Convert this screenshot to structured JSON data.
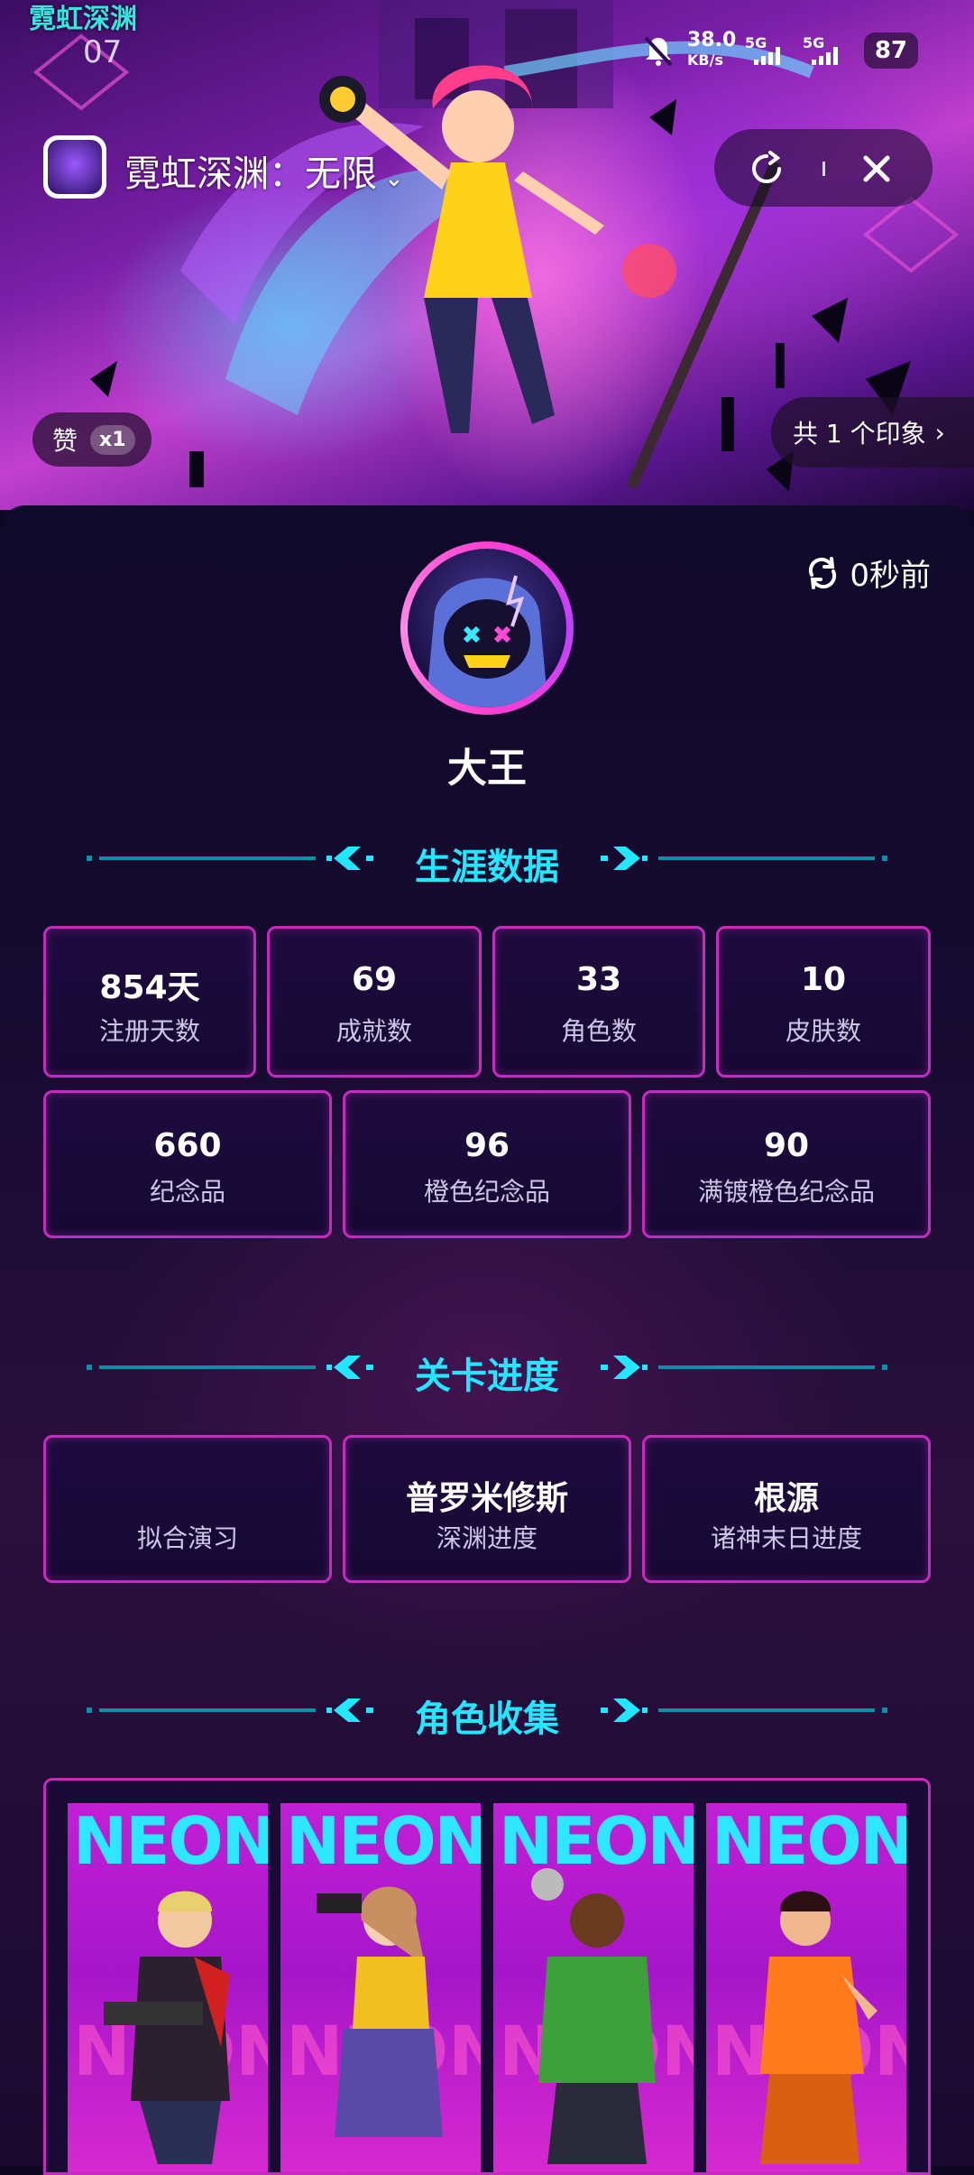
{
  "status_bar": {
    "logo": "霓虹深渊",
    "time": "07",
    "net_speed": "38.0",
    "net_unit": "KB/s",
    "sim1": "5G",
    "sim2": "5G",
    "battery": "87"
  },
  "header": {
    "app_name": "霓虹深渊：无限",
    "caret": "⌄",
    "refresh_icon": "refresh-circle-icon",
    "close_icon": "close-icon"
  },
  "banner": {
    "like_label": "赞",
    "like_count": "x1",
    "impressions": "共 1 个印象",
    "impressions_chevron": "›"
  },
  "profile": {
    "refresh_time": "0秒前",
    "player_name": "大王"
  },
  "career": {
    "title": "生涯数据",
    "row1": [
      {
        "value": "854天",
        "label": "注册天数"
      },
      {
        "value": "69",
        "label": "成就数"
      },
      {
        "value": "33",
        "label": "角色数"
      },
      {
        "value": "10",
        "label": "皮肤数"
      }
    ],
    "row2": [
      {
        "value": "660",
        "label": "纪念品"
      },
      {
        "value": "96",
        "label": "橙色纪念品"
      },
      {
        "value": "90",
        "label": "满镀橙色纪念品"
      }
    ]
  },
  "progress": {
    "title": "关卡进度",
    "items": [
      {
        "value": "",
        "label": "拟合演习"
      },
      {
        "value": "普罗米修斯",
        "label": "深渊进度"
      },
      {
        "value": "根源",
        "label": "诸神末日进度"
      }
    ]
  },
  "characters": {
    "title": "角色收集",
    "card_text": "NEON",
    "colors": {
      "blond": "#2b2030",
      "brown": "#f0c020",
      "green": "#3ea03a",
      "orange": "#ff7a1a"
    }
  },
  "colors": {
    "accent_cyan": "#23e6ff",
    "card_border": "#c42cc0",
    "background": "#0d0722"
  }
}
